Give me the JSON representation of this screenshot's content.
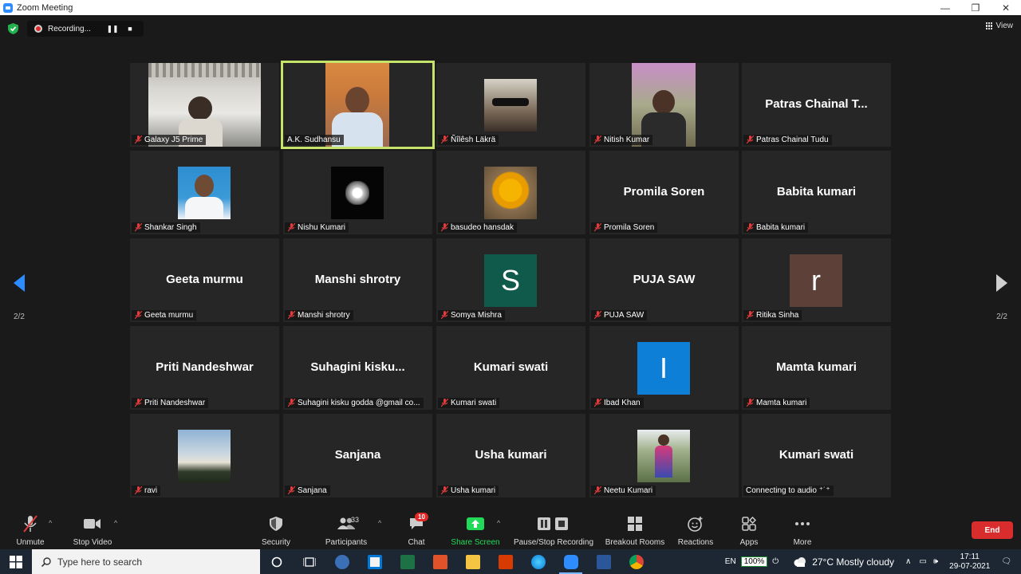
{
  "window": {
    "title": "Zoom Meeting",
    "controls": [
      "—",
      "❐",
      "✕"
    ]
  },
  "recording": {
    "status": "Recording...",
    "pause": "❚❚",
    "stop": "■"
  },
  "view": {
    "label": "View"
  },
  "pager": {
    "left": "2/2",
    "right": "2/2"
  },
  "tiles": [
    {
      "label": "Galaxy J5 Prime",
      "big": "",
      "type": "photo",
      "muted": true
    },
    {
      "label": "A.K. Sudhansu",
      "big": "",
      "type": "photo",
      "muted": false,
      "active": true
    },
    {
      "label": "Ñîlêsh Läkrä",
      "big": "",
      "type": "photo",
      "muted": true
    },
    {
      "label": "Nitish Kumar",
      "big": "",
      "type": "photo",
      "muted": true
    },
    {
      "label": "Patras Chainal Tudu",
      "big": "Patras Chainal T...",
      "type": "name",
      "muted": true
    },
    {
      "label": "Shankar Singh",
      "big": "",
      "type": "photo",
      "muted": true
    },
    {
      "label": "Nishu Kumari",
      "big": "",
      "type": "photo",
      "muted": true
    },
    {
      "label": "basudeo hansdak",
      "big": "",
      "type": "photo",
      "muted": true
    },
    {
      "label": "Promila Soren",
      "big": "Promila Soren",
      "type": "name",
      "muted": true
    },
    {
      "label": "Babita kumari",
      "big": "Babita kumari",
      "type": "name",
      "muted": true
    },
    {
      "label": "Geeta murmu",
      "big": "Geeta murmu",
      "type": "name",
      "muted": true
    },
    {
      "label": "Manshi shrotry",
      "big": "Manshi shrotry",
      "type": "name",
      "muted": true
    },
    {
      "label": "Somya Mishra",
      "big": "",
      "type": "letter",
      "letter": "S",
      "color": "#0f5a4b",
      "muted": true
    },
    {
      "label": "PUJA SAW",
      "big": "PUJA SAW",
      "type": "name",
      "muted": true
    },
    {
      "label": "Ritika Sinha",
      "big": "",
      "type": "letter",
      "letter": "r",
      "color": "#5d4037",
      "muted": true
    },
    {
      "label": "Priti Nandeshwar",
      "big": "Priti Nandeshwar",
      "type": "name",
      "muted": true
    },
    {
      "label": "Suhagini kisku godda   @gmail co...",
      "big": "Suhagini  kisku...",
      "type": "name",
      "muted": true
    },
    {
      "label": "Kumari swati",
      "big": "Kumari swati",
      "type": "name",
      "muted": true
    },
    {
      "label": "Ibad Khan",
      "big": "",
      "type": "letter",
      "letter": "I",
      "color": "#0e7fd6",
      "muted": true
    },
    {
      "label": "Mamta kumari",
      "big": "Mamta kumari",
      "type": "name",
      "muted": true
    },
    {
      "label": "ravi",
      "big": "",
      "type": "photo",
      "muted": true
    },
    {
      "label": "Sanjana",
      "big": "Sanjana",
      "type": "name",
      "muted": true
    },
    {
      "label": "Usha kumari",
      "big": "Usha kumari",
      "type": "name",
      "muted": true
    },
    {
      "label": "Neetu Kumari",
      "big": "",
      "type": "photo",
      "muted": true
    },
    {
      "label": "Connecting to audio ⁺˙⁺",
      "big": "Kumari swati",
      "type": "name",
      "muted": false
    }
  ],
  "toolbar": {
    "unmute": "Unmute",
    "stop_video": "Stop Video",
    "security": "Security",
    "participants": "Participants",
    "participant_count": "33",
    "chat": "Chat",
    "chat_badge": "10",
    "share_screen": "Share Screen",
    "pause_recording": "Pause/Stop Recording",
    "breakout": "Breakout Rooms",
    "reactions": "Reactions",
    "apps": "Apps",
    "more": "More",
    "end": "End",
    "caret": "^"
  },
  "taskbar": {
    "search_placeholder": "Type here to search",
    "lang": "EN",
    "battery": "100%",
    "weather": "27°C  Mostly cloudy",
    "time": "17:11",
    "date": "29-07-2021"
  },
  "colors": {
    "active_speaker": "#c6e36a",
    "end": "#d92c2c",
    "share": "#23d959"
  }
}
